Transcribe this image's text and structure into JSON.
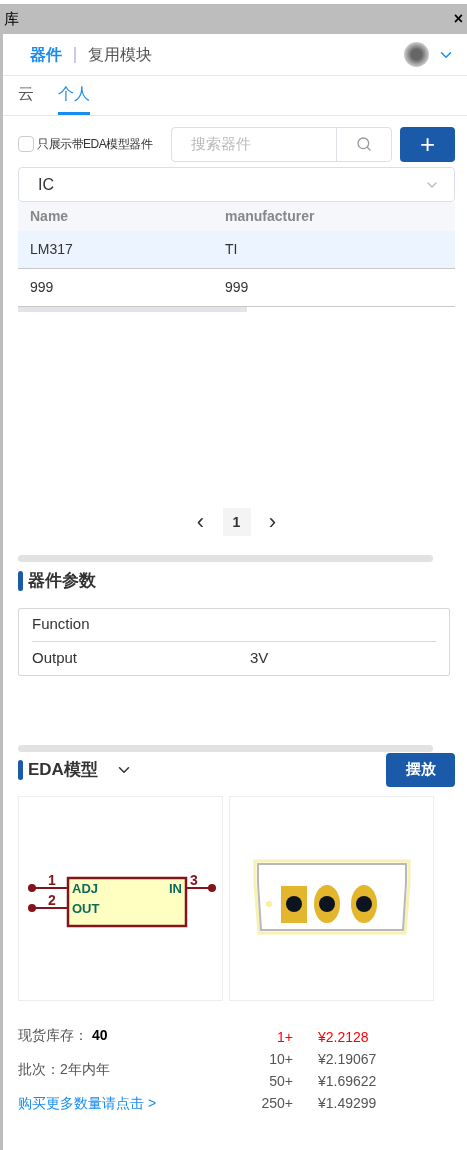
{
  "window": {
    "title": "库",
    "close": "×"
  },
  "top_tabs": [
    {
      "label": "器件",
      "selected": true
    },
    {
      "label": "复用模块",
      "selected": false
    }
  ],
  "source_tabs": [
    {
      "label": "云",
      "selected": false
    },
    {
      "label": "个人",
      "selected": true
    }
  ],
  "filter": {
    "label": "只展示带EDA模型器件",
    "checked": false
  },
  "search": {
    "placeholder": "搜索器件"
  },
  "add_button": "+",
  "category": {
    "value": "IC"
  },
  "table": {
    "columns": [
      "Name",
      "manufacturer"
    ],
    "rows": [
      {
        "cells": [
          "LM317",
          "TI"
        ],
        "selected": true
      },
      {
        "cells": [
          "999",
          "999"
        ],
        "selected": false
      }
    ]
  },
  "pagination": {
    "prev": "‹",
    "pages": [
      {
        "label": "1",
        "selected": true
      }
    ],
    "next": "›"
  },
  "params": {
    "title": "器件参数",
    "rows": [
      {
        "name": "Function",
        "value": ""
      },
      {
        "name": "Output",
        "value": "3V"
      }
    ]
  },
  "eda": {
    "title": "EDA模型",
    "place_button": "摆放",
    "symbol": {
      "left_pins": [
        {
          "number": "1",
          "label": "ADJ"
        },
        {
          "number": "2",
          "label": "OUT"
        }
      ],
      "right_pins": [
        {
          "number": "3",
          "label": "IN"
        }
      ]
    }
  },
  "stock": {
    "label": "现货库存：",
    "value": "40"
  },
  "batch": "批次：2年内年",
  "buy_link": "购买更多数量请点击 >",
  "prices": [
    {
      "qty": "1+",
      "price": "¥2.2128",
      "selected": true
    },
    {
      "qty": "10+",
      "price": "¥2.19067",
      "selected": false
    },
    {
      "qty": "50+",
      "price": "¥1.69622",
      "selected": false
    },
    {
      "qty": "250+",
      "price": "¥1.49299",
      "selected": false
    }
  ]
}
